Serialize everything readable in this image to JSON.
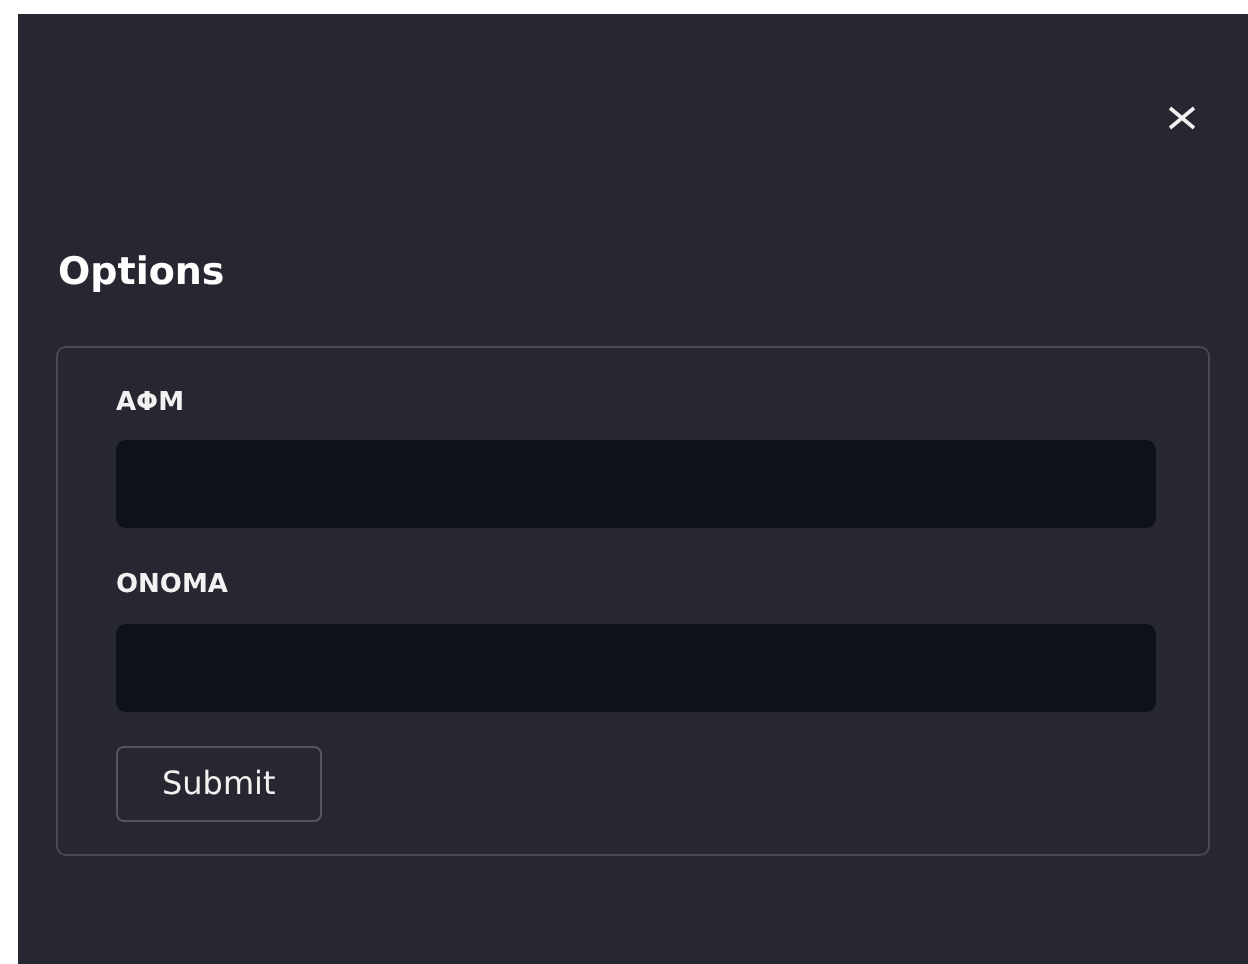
{
  "title": "Options",
  "fields": [
    {
      "label": "ΑΦΜ"
    },
    {
      "label": "ΟΝΟΜΑ"
    }
  ],
  "submit": "Submit"
}
